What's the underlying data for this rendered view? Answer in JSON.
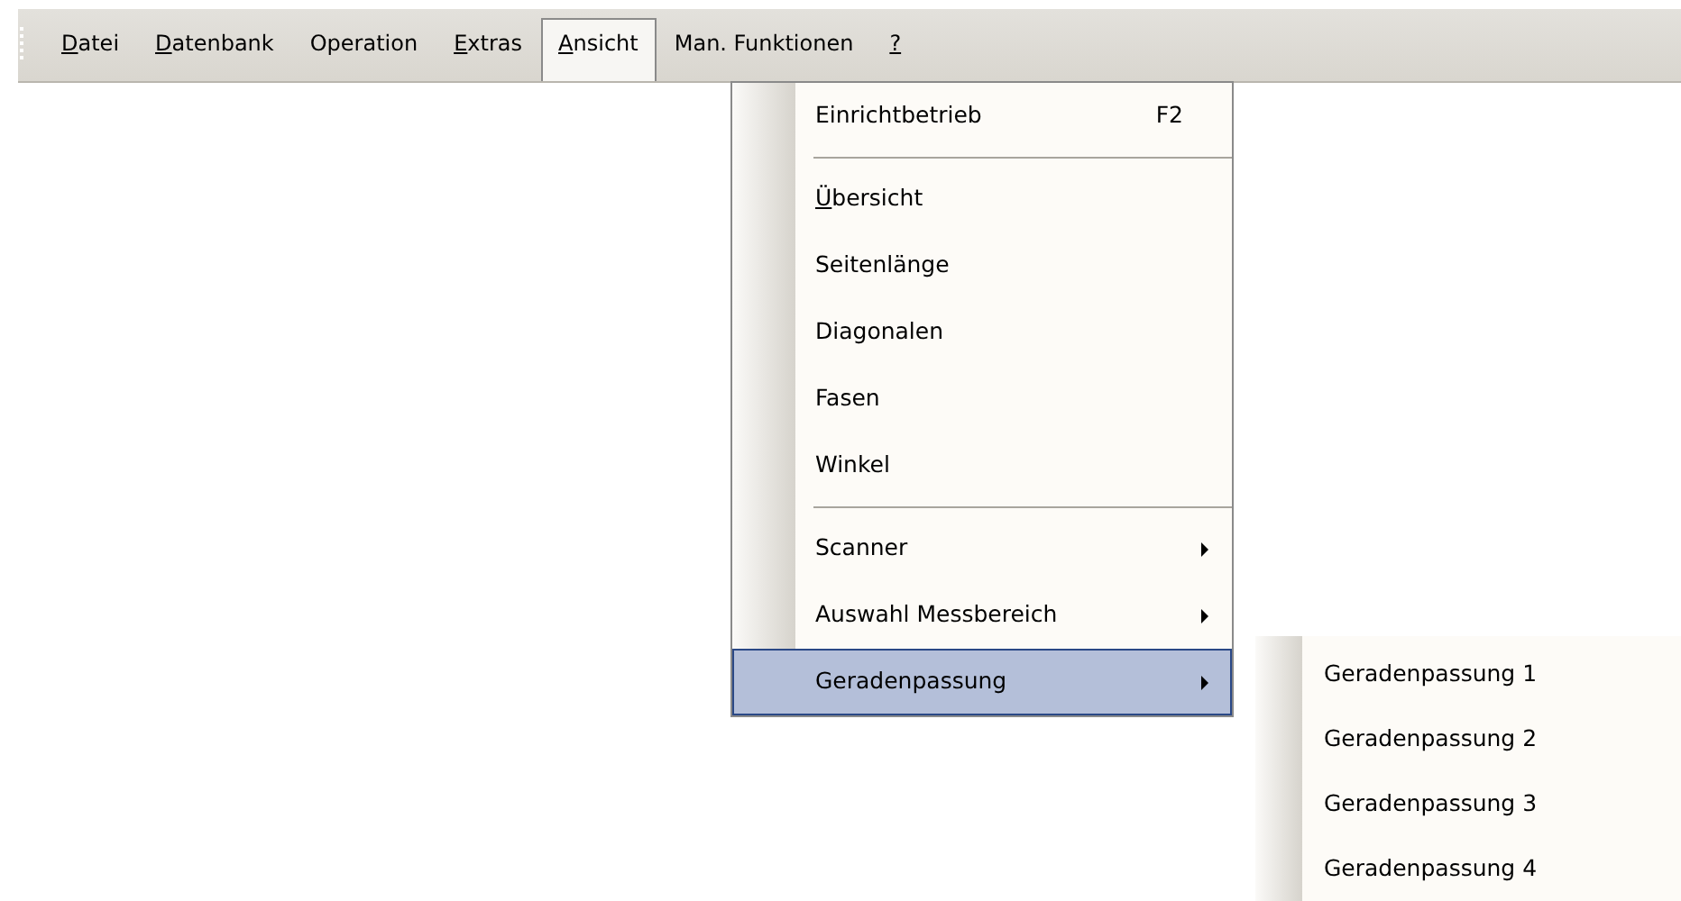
{
  "menu_bar": [
    {
      "label": "Datei",
      "mnemonic": true,
      "selected": false
    },
    {
      "label": "Datenbank",
      "mnemonic": true,
      "selected": false
    },
    {
      "label": "Operation",
      "mnemonic": false,
      "selected": false
    },
    {
      "label": "Extras",
      "mnemonic": true,
      "selected": false
    },
    {
      "label": "Ansicht",
      "mnemonic": true,
      "selected": true
    },
    {
      "label": "Man. Funktionen",
      "mnemonic": false,
      "selected": false
    },
    {
      "label": "?",
      "mnemonic": true,
      "selected": false
    }
  ],
  "dropdown": [
    {
      "kind": "item",
      "label": "Einrichtbetrieb",
      "shortcut": "F2",
      "mnemonic": false,
      "submenu": false,
      "selected": false
    },
    {
      "kind": "separator"
    },
    {
      "kind": "item",
      "label": "Übersicht",
      "mnemonic": true,
      "submenu": false,
      "selected": false
    },
    {
      "kind": "item",
      "label": "Seitenlänge",
      "mnemonic": false,
      "submenu": false,
      "selected": false
    },
    {
      "kind": "item",
      "label": "Diagonalen",
      "mnemonic": false,
      "submenu": false,
      "selected": false
    },
    {
      "kind": "item",
      "label": "Fasen",
      "mnemonic": false,
      "submenu": false,
      "selected": false
    },
    {
      "kind": "item",
      "label": "Winkel",
      "mnemonic": false,
      "submenu": false,
      "selected": false
    },
    {
      "kind": "separator"
    },
    {
      "kind": "item",
      "label": "Scanner",
      "mnemonic": false,
      "submenu": true,
      "selected": false
    },
    {
      "kind": "item",
      "label": "Auswahl Messbereich",
      "mnemonic": false,
      "submenu": true,
      "selected": false
    },
    {
      "kind": "item",
      "label": "Geradenpassung",
      "mnemonic": false,
      "submenu": true,
      "selected": true
    }
  ],
  "submenu": [
    {
      "label": "Geradenpassung 1"
    },
    {
      "label": "Geradenpassung 2"
    },
    {
      "label": "Geradenpassung 3"
    },
    {
      "label": "Geradenpassung 4"
    }
  ]
}
